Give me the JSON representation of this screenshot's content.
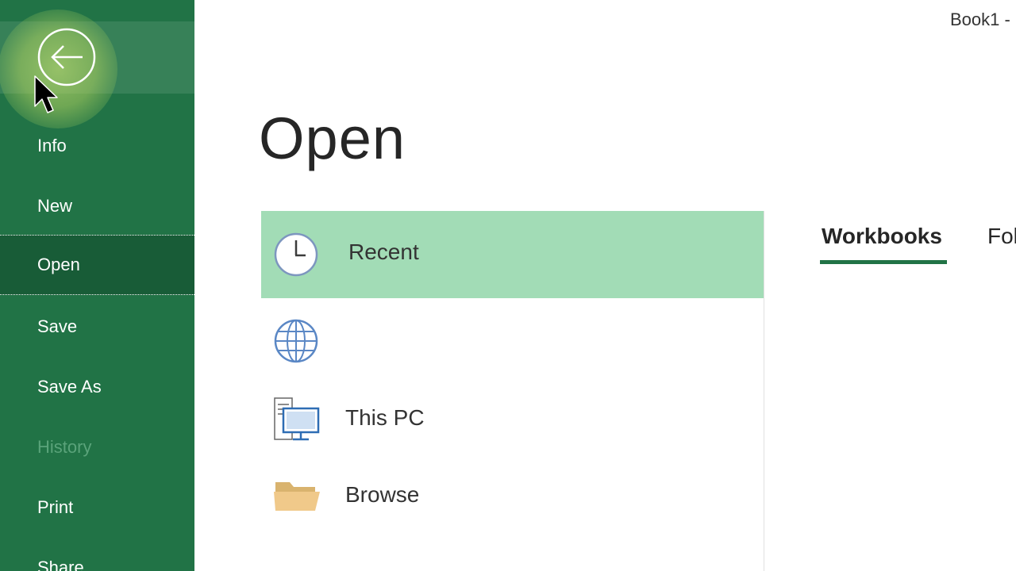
{
  "window": {
    "title_fragment": "Book1 -"
  },
  "sidebar": {
    "back_icon": "arrow-left-circle-icon",
    "items": [
      {
        "label": "Info",
        "state": "normal"
      },
      {
        "label": "New",
        "state": "normal"
      },
      {
        "label": "Open",
        "state": "selected"
      },
      {
        "label": "Save",
        "state": "normal"
      },
      {
        "label": "Save As",
        "state": "normal"
      },
      {
        "label": "History",
        "state": "disabled"
      },
      {
        "label": "Print",
        "state": "normal"
      },
      {
        "label": "Share",
        "state": "normal"
      }
    ]
  },
  "main": {
    "heading": "Open",
    "locations": [
      {
        "label": "Recent",
        "icon": "clock-icon",
        "selected": true
      },
      {
        "label": "",
        "icon": "globe-icon",
        "selected": false
      },
      {
        "label": "This PC",
        "icon": "computer-icon",
        "selected": false
      },
      {
        "label": "Browse",
        "icon": "folder-icon",
        "selected": false
      }
    ],
    "tabs": [
      {
        "label": "Workbooks",
        "active": true
      },
      {
        "label": "Fol",
        "active": false
      }
    ]
  },
  "colors": {
    "sidebar_bg": "#217346",
    "sidebar_selected": "#185c37",
    "location_selected": "#a2dcb6",
    "accent": "#217346"
  }
}
